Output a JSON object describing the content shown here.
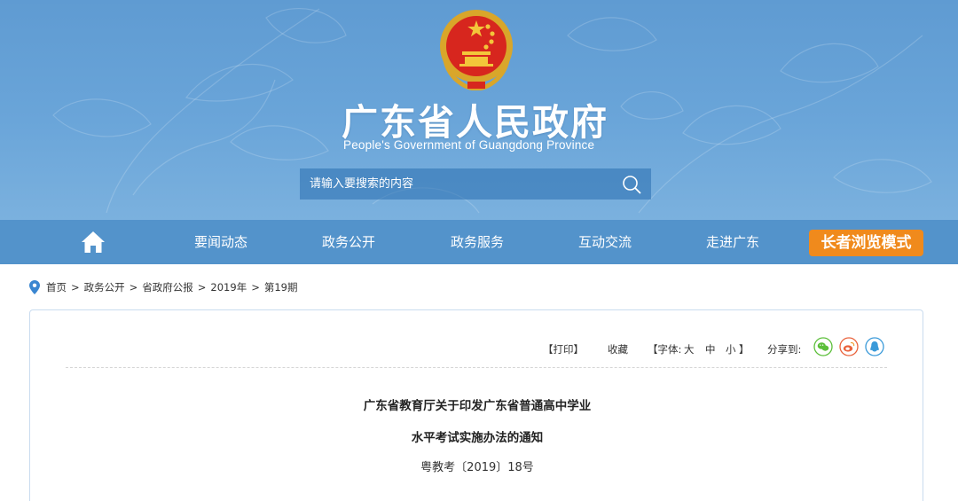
{
  "header": {
    "title": "广东省人民政府",
    "subtitle": "People's Government of Guangdong Province",
    "emblem": "national-emblem",
    "background_color": "#6aa5d9"
  },
  "search": {
    "placeholder": "请输入要搜索的内容",
    "icon": "search-icon"
  },
  "nav": {
    "home_icon": "home-icon",
    "items": [
      {
        "label": "要闻动态"
      },
      {
        "label": "政务公开"
      },
      {
        "label": "政务服务"
      },
      {
        "label": "互动交流"
      },
      {
        "label": "走进广东"
      }
    ],
    "elder_mode": "长者浏览模式",
    "bar_color": "#5393cb",
    "elder_color": "#f08a1c"
  },
  "breadcrumb": {
    "icon": "location-pin-icon",
    "items": [
      "首页",
      "政务公开",
      "省政府公报",
      "2019年",
      "第19期"
    ],
    "separator": ">"
  },
  "toolbar": {
    "print": "【打印】",
    "favorite": "收藏",
    "font_prefix": "【字体:",
    "font_large": "大",
    "font_medium": "中",
    "font_small": "小",
    "font_suffix": "】",
    "share_label": "分享到:",
    "share_icons": [
      "wechat-icon",
      "weibo-icon",
      "qq-icon"
    ]
  },
  "document": {
    "title_line1": "广东省教育厅关于印发广东省普通高中学业",
    "title_line2": "水平考试实施办法的通知",
    "number": "粤教考〔2019〕18号"
  }
}
